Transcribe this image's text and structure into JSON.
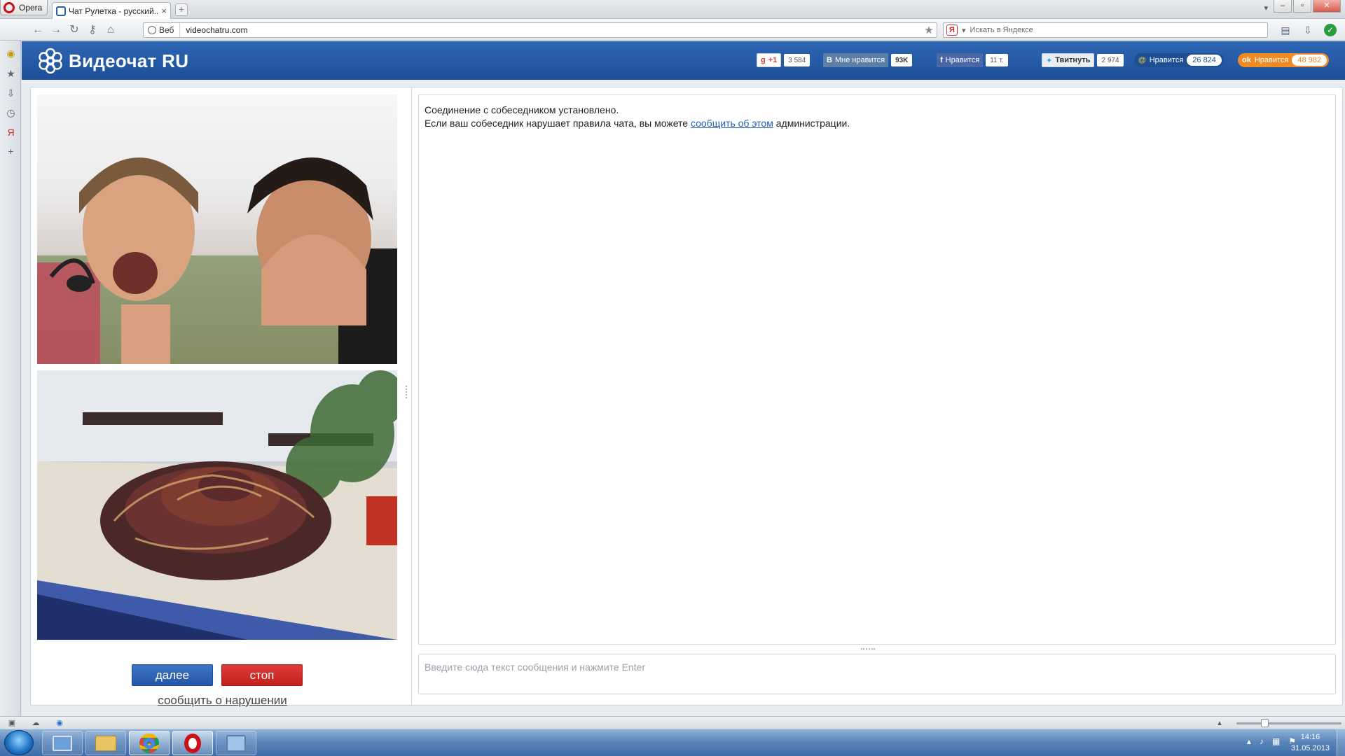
{
  "browser": {
    "menu_label": "Opera",
    "tab_title": "Чат Рулетка - русский...",
    "tab_close": "×",
    "new_tab": "+",
    "address_mode": "Веб",
    "url": "videochatru.com",
    "search_placeholder": "Искать в Яндексе",
    "search_engine_icon": "Я"
  },
  "site": {
    "logo_text": "Видеочат RU",
    "social": {
      "gplus": {
        "label": "+1",
        "count": "3 584"
      },
      "vk": {
        "label": "Мне нравится",
        "count": "93K"
      },
      "facebook": {
        "label": "Нравится",
        "count": "11 т."
      },
      "twitter": {
        "label": "Твитнуть",
        "count": "2 974"
      },
      "mailru": {
        "label": "Нравится",
        "count": "26 824"
      },
      "odnoklassniki": {
        "label": "Нравится",
        "count": "48 982"
      }
    },
    "buttons": {
      "next": "далее",
      "stop": "стоп",
      "report": "сообщить о нарушении"
    },
    "chat": {
      "line1": "Соединение с собеседником установлено.",
      "line2_before": "Если ваш собеседник нарушает правила чата, вы можете ",
      "line2_link": "сообщить об этом",
      "line2_after": " администрации.",
      "input_placeholder": "Введите сюда текст сообщения и нажмите Enter"
    }
  },
  "taskbar": {
    "time": "14:16",
    "date": "31.05.2013"
  },
  "colors": {
    "header_blue": "#2d66b4",
    "next_button": "#2f63b4",
    "stop_button": "#d22c2a",
    "link": "#1f5fb4",
    "odnoklassniki": "#f08a24"
  }
}
